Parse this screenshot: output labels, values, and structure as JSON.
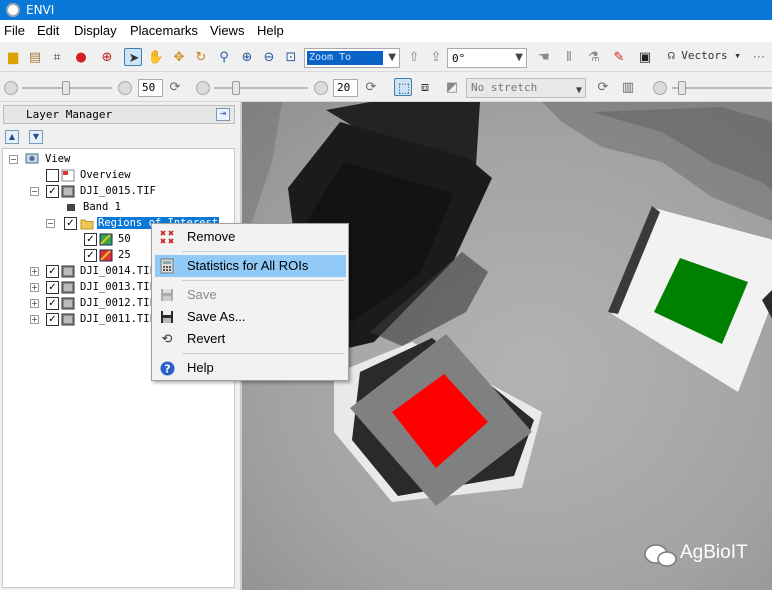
{
  "window": {
    "title": "ENVI"
  },
  "menubar": [
    "File",
    "Edit",
    "Display",
    "Placemarks",
    "Views",
    "Help"
  ],
  "toolbar": {
    "zoom_value": "Zoom To",
    "rotation_value": "0°",
    "vectors_label": "Vectors"
  },
  "toolbar2": {
    "brightness_value": "50",
    "contrast_value": "20",
    "stretch_value": "No stretch"
  },
  "layer_manager": {
    "title": "Layer Manager",
    "tree": {
      "root": "View",
      "overview": "Overview",
      "file1": "DJI_0015.TIF",
      "band": "Band 1",
      "regions": "Regions of Interest",
      "roi1": "50",
      "roi2": "25",
      "file2": "DJI_0014.TIF",
      "file3": "DJI_0013.TIF",
      "file4": "DJI_0012.TIF",
      "file5": "DJI_0011.TIF"
    }
  },
  "context_menu": {
    "items": [
      {
        "label": "Remove",
        "icon": "remove-icon",
        "enabled": true
      },
      {
        "label": "Statistics for All ROIs",
        "icon": "statistics-icon",
        "enabled": true,
        "highlighted": true
      },
      {
        "label": "Save",
        "icon": "save-icon",
        "enabled": false
      },
      {
        "label": "Save As...",
        "icon": "save-as-icon",
        "enabled": true
      },
      {
        "label": "Revert",
        "icon": "revert-icon",
        "enabled": true
      },
      {
        "label": "Help",
        "icon": "help-icon",
        "enabled": true
      }
    ]
  },
  "watermark": {
    "text": "AgBioIT"
  },
  "colors": {
    "title_bar": "#0a78d7",
    "selection": "#0a78d7",
    "menu_highlight": "#91c9f7",
    "roi_red": "#ff0000",
    "roi_green": "#008000"
  }
}
